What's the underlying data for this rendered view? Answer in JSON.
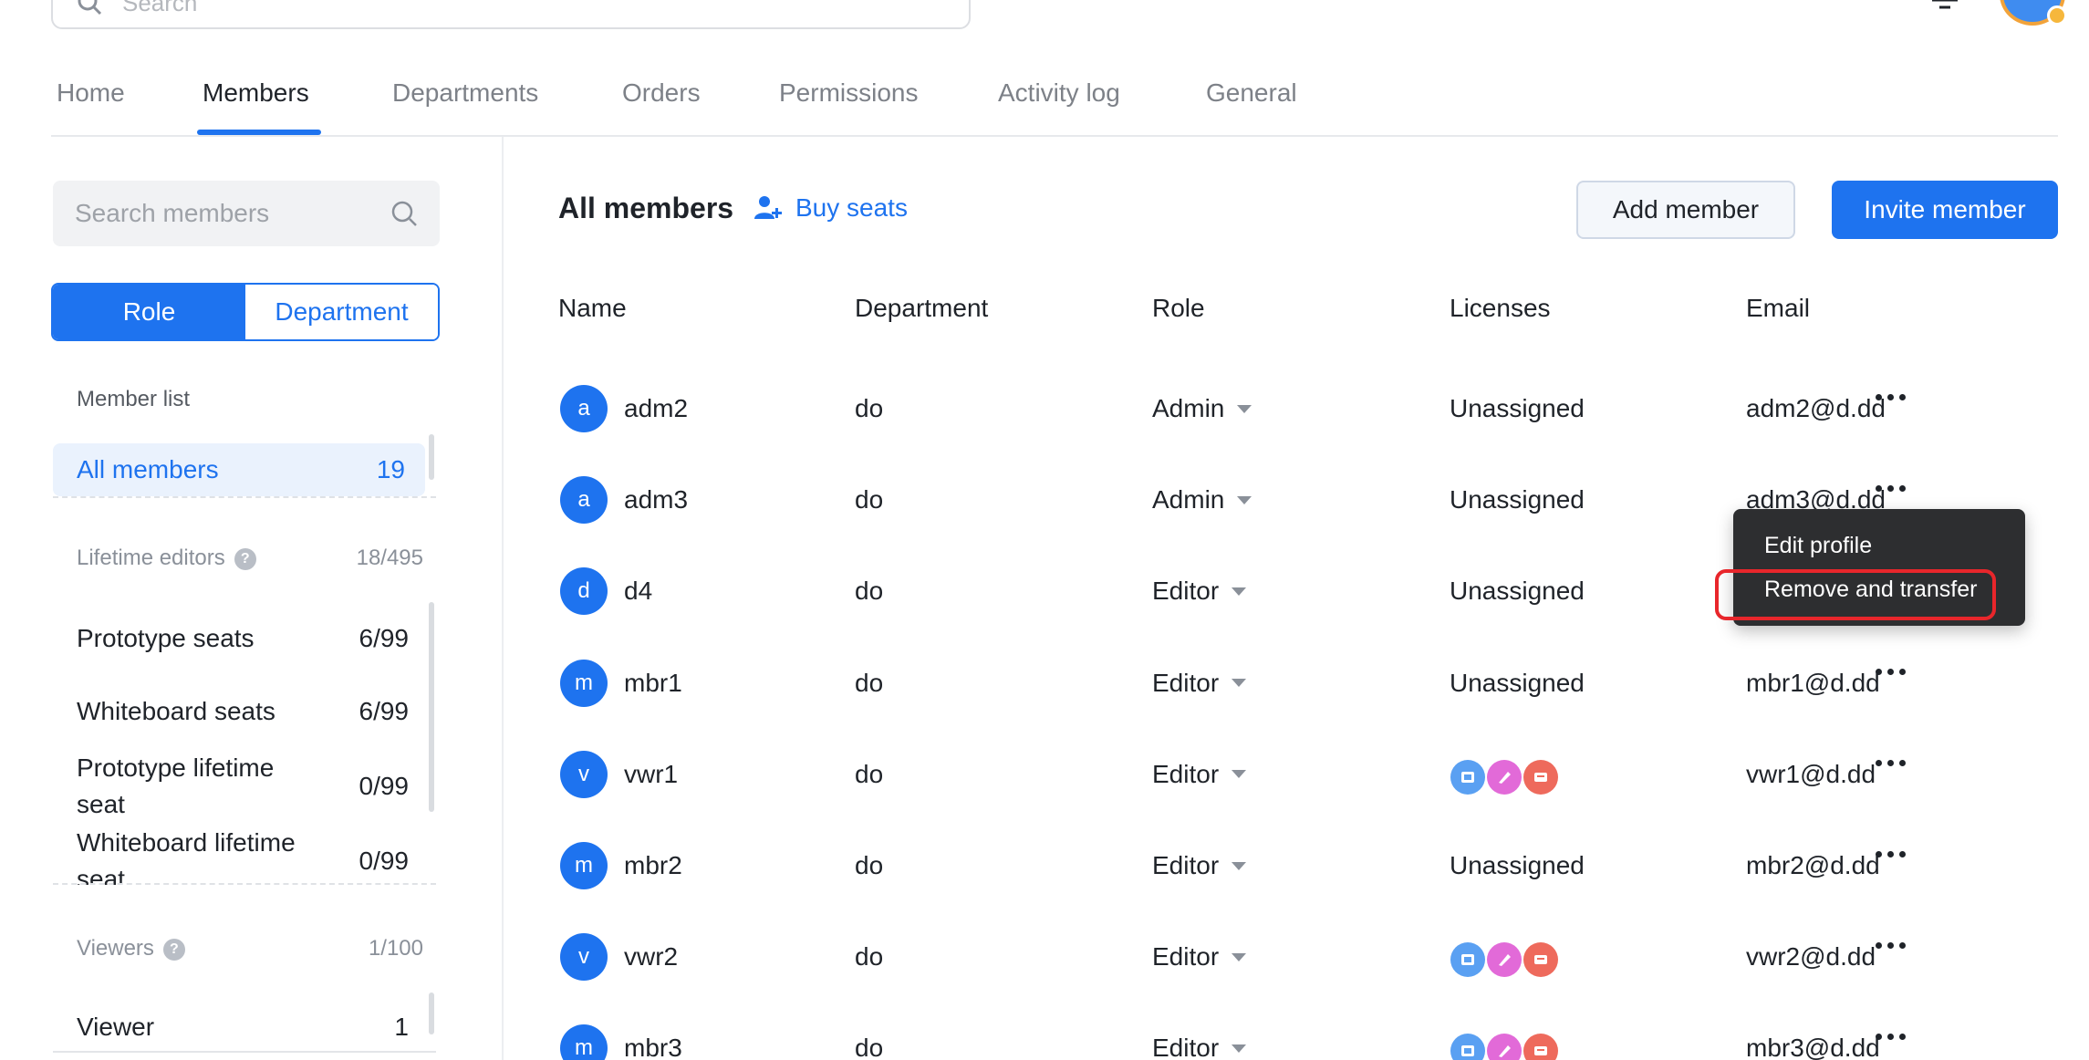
{
  "top": {
    "search_placeholder": "Search"
  },
  "tabs": [
    "Home",
    "Members",
    "Departments",
    "Orders",
    "Permissions",
    "Activity log",
    "General"
  ],
  "sidebar": {
    "search_placeholder": "Search members",
    "toggle": {
      "role": "Role",
      "department": "Department"
    },
    "member_list_heading": "Member list",
    "all_members": {
      "label": "All members",
      "count": "19"
    },
    "lifetime_editors": {
      "label": "Lifetime editors",
      "count": "18/495"
    },
    "seats": [
      {
        "label": "Prototype seats",
        "count": "6/99"
      },
      {
        "label": "Whiteboard seats",
        "count": "6/99"
      },
      {
        "label": "Prototype lifetime seat",
        "count": "0/99"
      },
      {
        "label": "Whiteboard lifetime seat",
        "count": "0/99"
      }
    ],
    "viewers": {
      "label": "Viewers",
      "count": "1/100"
    },
    "viewer_row": {
      "label": "Viewer",
      "count": "1"
    }
  },
  "main": {
    "title": "All members",
    "buy_seats": "Buy seats",
    "add_member": "Add member",
    "invite_member": "Invite member",
    "columns": [
      "Name",
      "Department",
      "Role",
      "Licenses",
      "Email"
    ]
  },
  "rows": [
    {
      "initial": "a",
      "name": "adm2",
      "department": "do",
      "role": "Admin",
      "licenses": "Unassigned",
      "email": "adm2@d.dd"
    },
    {
      "initial": "a",
      "name": "adm3",
      "department": "do",
      "role": "Admin",
      "licenses": "Unassigned",
      "email": "adm3@d.dd"
    },
    {
      "initial": "d",
      "name": "d4",
      "department": "do",
      "role": "Editor",
      "licenses": "Unassigned",
      "email": ""
    },
    {
      "initial": "m",
      "name": "mbr1",
      "department": "do",
      "role": "Editor",
      "licenses": "Unassigned",
      "email": "mbr1@d.dd"
    },
    {
      "initial": "v",
      "name": "vwr1",
      "department": "do",
      "role": "Editor",
      "licenses": "",
      "email": "vwr1@d.dd"
    },
    {
      "initial": "m",
      "name": "mbr2",
      "department": "do",
      "role": "Editor",
      "licenses": "Unassigned",
      "email": "mbr2@d.dd"
    },
    {
      "initial": "v",
      "name": "vwr2",
      "department": "do",
      "role": "Editor",
      "licenses": "",
      "email": "vwr2@d.dd"
    },
    {
      "initial": "m",
      "name": "mbr3",
      "department": "do",
      "role": "Editor",
      "licenses": "",
      "email": "mbr3@d.dd"
    }
  ],
  "context_menu": {
    "edit_profile": "Edit profile",
    "remove_and_transfer": "Remove and transfer"
  },
  "colors": {
    "accent": "#1e73ef",
    "menu_bg": "#2d2e30",
    "highlight": "#e8262b"
  },
  "icons": [
    "search-icon",
    "bell-icon",
    "user-add-icon",
    "more-icon",
    "prototype-license-icon",
    "whiteboard-license-icon",
    "slides-license-icon"
  ]
}
